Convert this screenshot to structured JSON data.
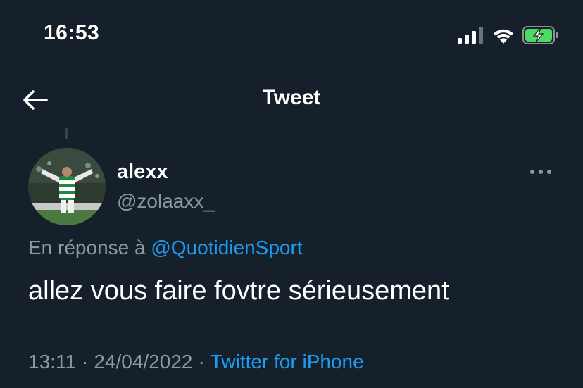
{
  "status_bar": {
    "time": "16:53",
    "icons": [
      "signal-icon",
      "wifi-icon",
      "battery-charging-icon"
    ],
    "battery_color": "#4cd964"
  },
  "header": {
    "back_icon": "arrow-left-icon",
    "title": "Tweet"
  },
  "tweet": {
    "author_name": "alexx",
    "author_handle": "@zolaaxx_",
    "more_icon": "more-dots-icon",
    "reply_prefix": "En réponse à",
    "reply_handle": "@QuotidienSport",
    "text": "allez vous faire fovtre sérieusement",
    "time": "13:11",
    "separator": "·",
    "date": "24/04/2022",
    "source": "Twitter for iPhone"
  },
  "colors": {
    "background": "#15202b",
    "text": "#ffffff",
    "muted": "#8b98a5",
    "accent": "#1d9bf0"
  }
}
